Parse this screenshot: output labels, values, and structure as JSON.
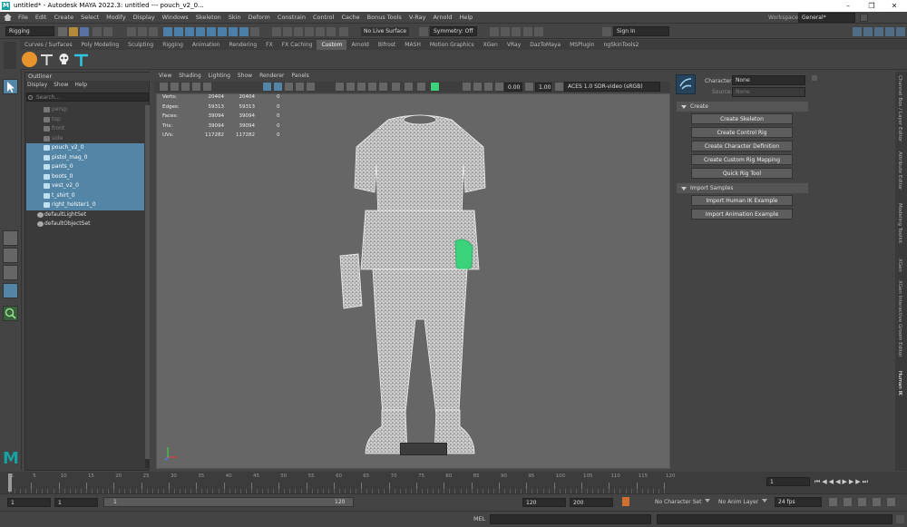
{
  "window": {
    "title": "untitled* - Autodesk MAYA 2022.3: untitled   ---   pouch_v2_0...",
    "app_icon": "M",
    "controls": [
      "minimize",
      "maximize",
      "close"
    ]
  },
  "menubar": {
    "items": [
      "File",
      "Edit",
      "Create",
      "Select",
      "Modify",
      "Display",
      "Windows",
      "Skeleton",
      "Skin",
      "Deform",
      "Constrain",
      "Control",
      "Cache",
      "Bonus Tools",
      "V-Ray",
      "Arnold",
      "Help"
    ],
    "workspace_label": "Workspace:",
    "workspace_value": "General*"
  },
  "statusline": {
    "menuset": "Rigging",
    "live_surface": "No Live Surface",
    "symmetry": "Symmetry: Off",
    "sign_in": "Sign In"
  },
  "shelf": {
    "tabs": [
      "Curves / Surfaces",
      "Poly Modeling",
      "Sculpting",
      "Rigging",
      "Animation",
      "Rendering",
      "FX",
      "FX Caching",
      "Custom",
      "Arnold",
      "Bifrost",
      "MASH",
      "Motion Graphics",
      "XGen",
      "VRay",
      "DazToMaya",
      "MSPlugin",
      "ngSkinTools2"
    ],
    "active_tab": "Custom"
  },
  "outliner": {
    "title": "Outliner",
    "menus": [
      "Display",
      "Show",
      "Help"
    ],
    "search_placeholder": "Search...",
    "cameras": [
      "persp",
      "top",
      "front",
      "side"
    ],
    "selected": [
      "pouch_v2_0",
      "pistol_mag_0",
      "pants_0",
      "boots_0",
      "vest_v2_0",
      "t_shirt_0",
      "right_holster1_0"
    ],
    "sets": [
      "defaultLightSet",
      "defaultObjectSet"
    ]
  },
  "viewport": {
    "menus": [
      "View",
      "Shading",
      "Lighting",
      "Show",
      "Renderer",
      "Panels"
    ],
    "exposure": "0.00",
    "gamma": "1.00",
    "colorspace": "ACES 1.0 SDR-video (sRGB)",
    "hud": [
      {
        "label": "Verts:",
        "a": "20404",
        "b": "20404",
        "c": "0"
      },
      {
        "label": "Edges:",
        "a": "59313",
        "b": "59313",
        "c": "0"
      },
      {
        "label": "Faces:",
        "a": "39094",
        "b": "39094",
        "c": "0"
      },
      {
        "label": "Tris:",
        "a": "39094",
        "b": "39094",
        "c": "0"
      },
      {
        "label": "UVs:",
        "a": "117282",
        "b": "117282",
        "c": "0"
      }
    ]
  },
  "humanik": {
    "character_label": "Character:",
    "character_value": "None",
    "source_label": "Source:",
    "source_value": "None",
    "section_create": "Create",
    "create_buttons": [
      "Create Skeleton",
      "Create Control Rig",
      "Create Character Definition",
      "Create Custom Rig Mapping",
      "Quick Rig Tool"
    ],
    "section_import": "Import Samples",
    "import_buttons": [
      "Import Human IK Example",
      "Import Animation Example"
    ]
  },
  "side_tabs": [
    "Channel Box / Layer Editor",
    "Attribute Editor",
    "Modeling Toolkit",
    "XGen",
    "XGen Interactive Groom Editor",
    "Human IK"
  ],
  "timeline": {
    "ticks": [
      "1",
      "5",
      "10",
      "15",
      "20",
      "25",
      "30",
      "35",
      "40",
      "45",
      "50",
      "55",
      "60",
      "65",
      "70",
      "75",
      "80",
      "85",
      "90",
      "95",
      "100",
      "105",
      "110",
      "115",
      "120"
    ],
    "current_frame": "1"
  },
  "range": {
    "start": "1",
    "anim_start": "1",
    "slider_start": "1",
    "slider_end": "120",
    "anim_end": "120",
    "end": "200",
    "character_set": "No Character Set",
    "anim_layer": "No Anim Layer",
    "fps": "24 fps"
  },
  "cmdline": {
    "label": "MEL"
  },
  "colors": {
    "selection": "#5285a6",
    "accent": "#16a1a3",
    "highlight_mesh": "#3ad37c"
  }
}
